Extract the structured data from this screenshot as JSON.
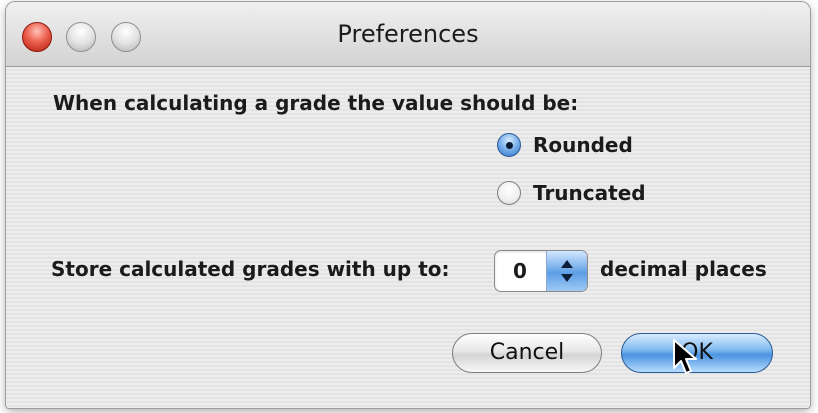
{
  "window": {
    "title": "Preferences"
  },
  "grade_rounding": {
    "prompt": "When calculating a grade the value should be:",
    "options": [
      {
        "label": "Rounded",
        "checked": true
      },
      {
        "label": "Truncated",
        "checked": false
      }
    ]
  },
  "decimal_places": {
    "prefix": "Store calculated grades with up to:",
    "value": "0",
    "suffix": "decimal places"
  },
  "buttons": {
    "cancel": "Cancel",
    "ok": "OK"
  },
  "icons": {
    "close": "close-icon",
    "minimize": "minimize-icon",
    "zoom": "zoom-icon",
    "cursor": "mouse-pointer-icon"
  },
  "colors": {
    "close_button": "#e0493a",
    "default_button": "#5c9ee6",
    "selected_radio": "#3d7fd4"
  }
}
